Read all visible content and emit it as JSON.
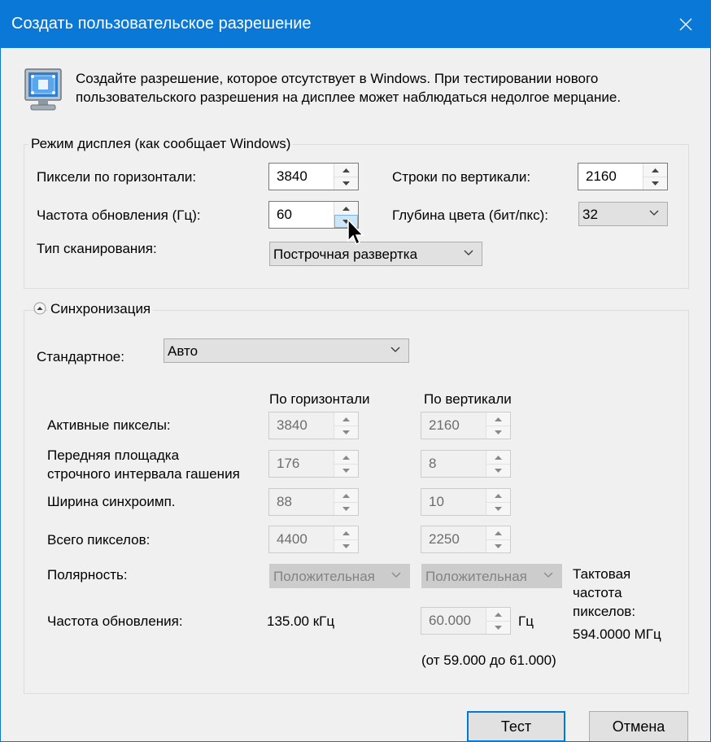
{
  "window": {
    "title": "Создать пользовательское разрешение",
    "intro": "Создайте разрешение, которое отсутствует в Windows. При тестировании нового пользовательского разрешения на дисплее может наблюдаться недолгое мерцание."
  },
  "display_mode": {
    "legend": "Режим дисплея (как сообщает Windows)",
    "h_pixels_label": "Пиксели по горизонтали:",
    "h_pixels_value": "3840",
    "v_lines_label": "Строки по вертикали:",
    "v_lines_value": "2160",
    "refresh_label": "Частота обновления (Гц):",
    "refresh_value": "60",
    "depth_label": "Глубина цвета (бит/пкс):",
    "depth_value": "32",
    "scan_label": "Тип сканирования:",
    "scan_value": "Построчная развертка"
  },
  "timing": {
    "legend": "Синхронизация",
    "standard_label": "Стандартное:",
    "standard_value": "Авто",
    "col_h": "По горизонтали",
    "col_v": "По вертикали",
    "active_label": "Активные пикселы:",
    "active_h": "3840",
    "active_v": "2160",
    "front_porch_label_1": "Передняя площадка",
    "front_porch_label_2": "строчного интервала гашения",
    "front_porch_h": "176",
    "front_porch_v": "8",
    "sync_width_label": "Ширина синхроимп.",
    "sync_width_h": "88",
    "sync_width_v": "10",
    "total_label": "Всего пикселов:",
    "total_h": "4400",
    "total_v": "2250",
    "polarity_label": "Полярность:",
    "polarity_h": "Положительная",
    "polarity_v": "Положительная",
    "refresh_label": "Частота обновления:",
    "refresh_h": "135.00 кГц",
    "refresh_v": "60.000",
    "refresh_unit": "Гц",
    "refresh_range": "(от 59.000 до 61.000)",
    "pixel_clock_label_1": "Тактовая",
    "pixel_clock_label_2": "частота",
    "pixel_clock_label_3": "пикселов:",
    "pixel_clock_value": "594.0000 МГц"
  },
  "buttons": {
    "test": "Тест",
    "cancel": "Отмена"
  },
  "colors": {
    "titlebar": "#0a78d7",
    "dialog_bg": "#f0f0f0",
    "default_button_border": "#0078d7"
  }
}
